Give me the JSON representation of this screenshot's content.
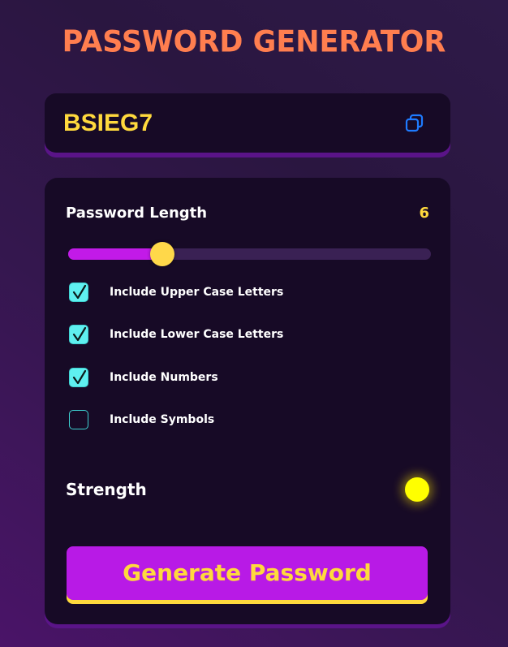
{
  "header": {
    "title": "PASSWORD GENERATOR"
  },
  "password": {
    "value": "BSIEG7",
    "copy_icon": "copy-icon"
  },
  "length": {
    "label": "Password Length",
    "value": "6",
    "slider_fraction": 0.26
  },
  "options": [
    {
      "label": "Include Upper Case Letters",
      "checked": true
    },
    {
      "label": "Include Lower Case Letters",
      "checked": true
    },
    {
      "label": "Include Numbers",
      "checked": true
    },
    {
      "label": "Include Symbols",
      "checked": false
    }
  ],
  "strength": {
    "label": "Strength",
    "indicator_color": "#ffff00"
  },
  "generate": {
    "label": "Generate Password"
  },
  "colors": {
    "accent": "#c21ae8",
    "title": "#ff7e4f",
    "highlight": "#ffd93d",
    "checkbox": "#5ff0f0",
    "copy_icon": "#1e7bff"
  }
}
